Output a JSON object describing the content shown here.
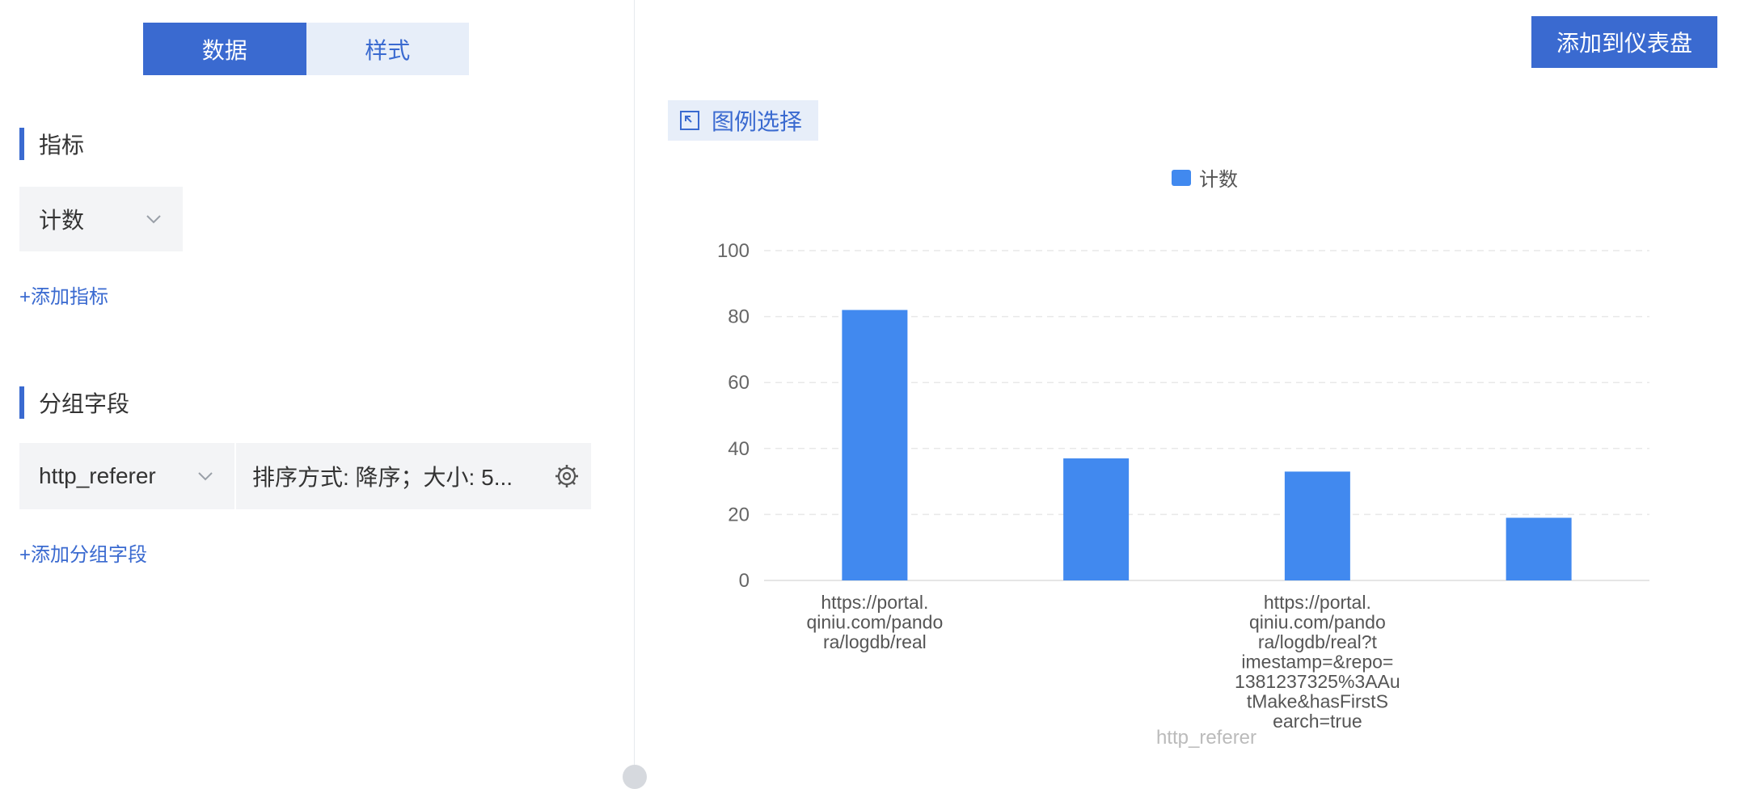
{
  "tabs": {
    "data_label": "数据",
    "style_label": "样式"
  },
  "metrics": {
    "title": "指标",
    "selected": "计数",
    "add_label": "+添加指标"
  },
  "grouping": {
    "title": "分组字段",
    "field": "http_referer",
    "sort_summary": "排序方式: 降序；大小: 5...",
    "add_label": "+添加分组字段"
  },
  "toolbar": {
    "add_to_dashboard": "添加到仪表盘"
  },
  "legend_select_label": "图例选择",
  "icons": {
    "chevron": "chevron-down-icon",
    "gear": "gear-icon",
    "legend_select": "select-arrow-icon"
  },
  "colors": {
    "accent": "#3a6ad0",
    "bar": "#4189ef"
  },
  "chart_data": {
    "type": "bar",
    "categories": [
      "https://portal.qiniu.com/pandora/logdb/real",
      "",
      "https://portal.qiniu.com/pandora/logdb/real?timestamp=&repo=1381237325%3AAutMake&hasFirstSearch=true",
      ""
    ],
    "category_lines": [
      [
        "https://portal.",
        "qiniu.com/pando",
        "ra/logdb/real"
      ],
      [],
      [
        "https://portal.",
        "qiniu.com/pando",
        "ra/logdb/real?t",
        "imestamp=&repo=",
        "1381237325%3AAu",
        "tMake&hasFirstS",
        "earch=true"
      ],
      []
    ],
    "series": [
      {
        "name": "计数",
        "values": [
          82,
          37,
          33,
          19
        ]
      }
    ],
    "xlabel": "http_referer",
    "ylabel": "",
    "ylim": [
      0,
      100
    ],
    "yticks": [
      0,
      20,
      40,
      60,
      80,
      100
    ],
    "grid": true,
    "legend_position": "top-center"
  }
}
